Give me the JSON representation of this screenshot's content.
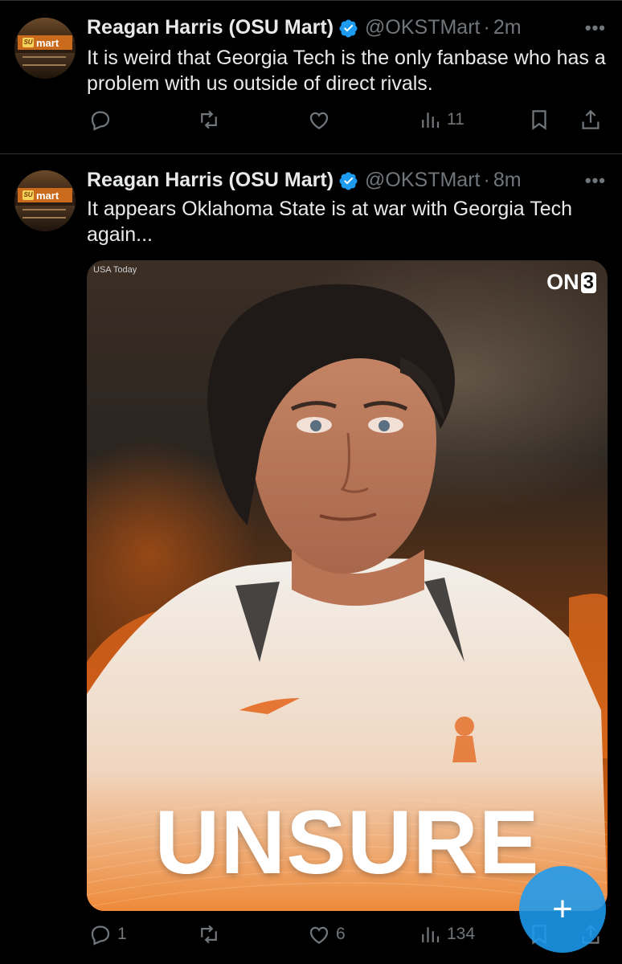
{
  "tweets": [
    {
      "author_name": "Reagan Harris (OSU Mart)",
      "handle": "@OKSTMart",
      "separator": "·",
      "time": "2m",
      "text": "It is weird that Georgia Tech is the only fanbase who has a problem with us outside of direct rivals.",
      "replies": "",
      "reposts": "",
      "likes": "",
      "views": "11",
      "avatar_sign": "mart",
      "avatar_logo": "SU"
    },
    {
      "author_name": "Reagan Harris (OSU Mart)",
      "handle": "@OKSTMart",
      "separator": "·",
      "time": "8m",
      "text": "It appears Oklahoma State is at war with Georgia Tech again...",
      "replies": "1",
      "reposts": "",
      "likes": "6",
      "views": "134",
      "avatar_sign": "mart",
      "avatar_logo": "SU",
      "media": {
        "credit": "USA Today",
        "brand_prefix": "ON",
        "brand_suffix": "3",
        "headline": "UNSURE"
      }
    }
  ],
  "fab_label": "+",
  "colors": {
    "background": "#000000",
    "text": "#e7e9ea",
    "muted": "#71767b",
    "accent": "#1d9bf0",
    "divider": "#2f3336"
  },
  "icons": [
    "more-icon",
    "verified-icon",
    "reply-icon",
    "repost-icon",
    "like-icon",
    "views-icon",
    "bookmark-icon",
    "share-icon",
    "compose-icon"
  ]
}
